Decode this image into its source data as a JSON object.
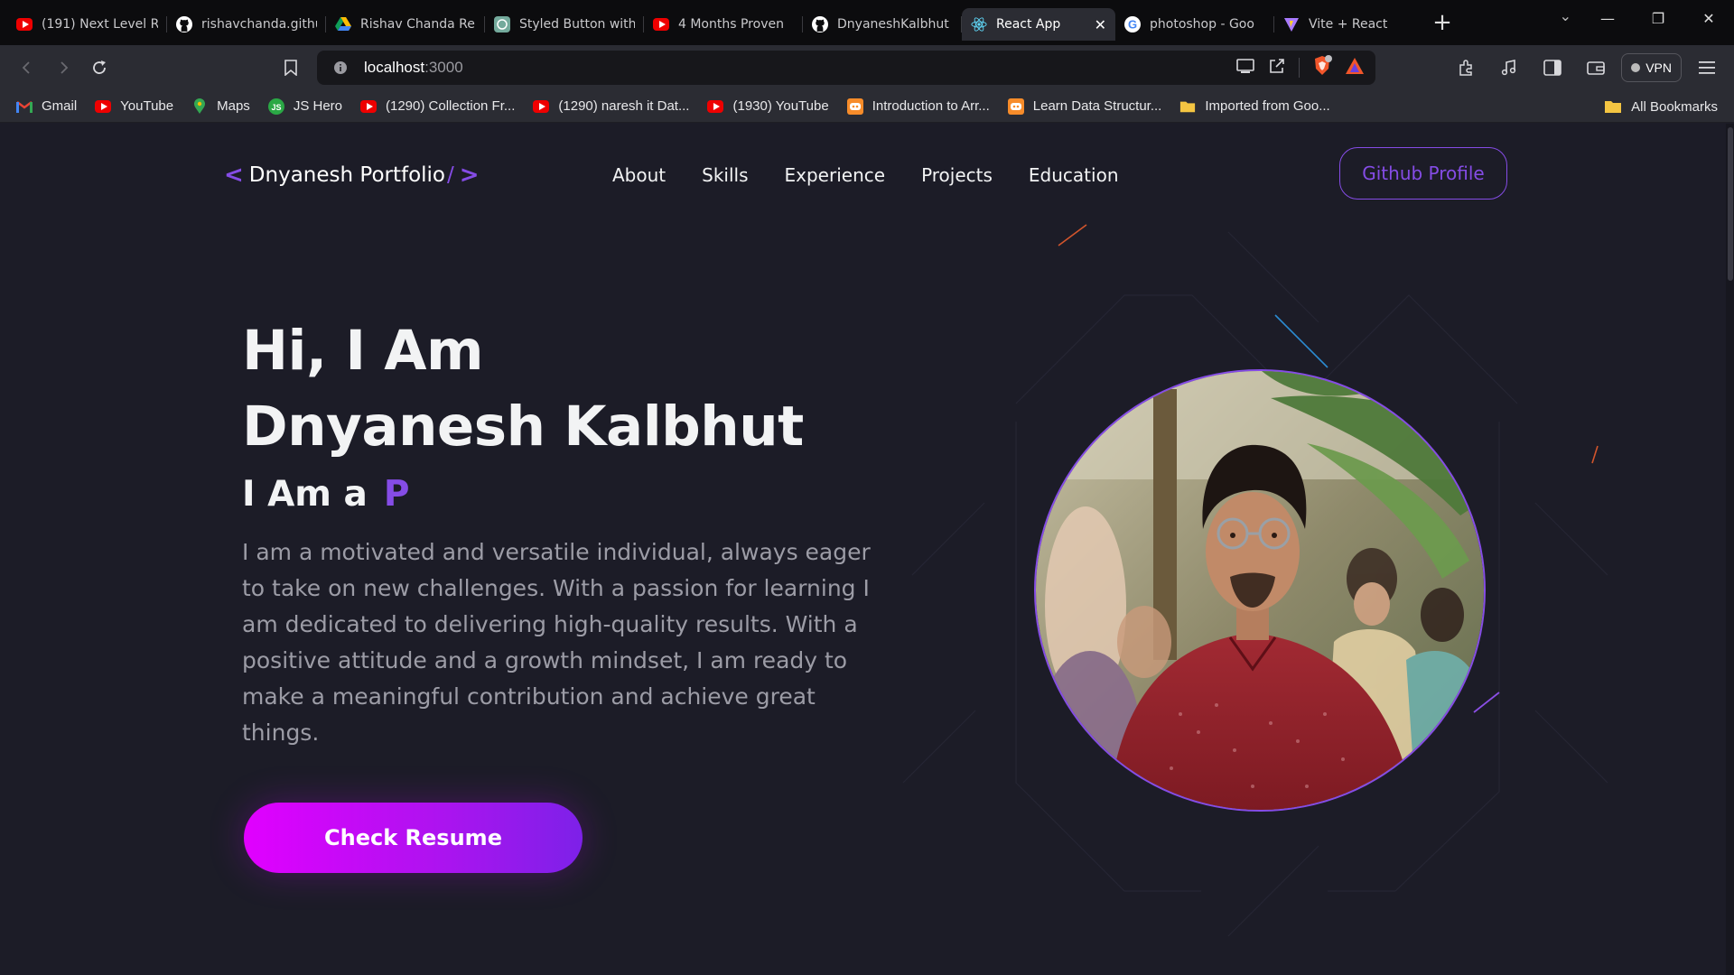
{
  "browser": {
    "tabs": [
      {
        "title": "(191) Next Level R",
        "icon": "youtube-icon"
      },
      {
        "title": "rishavchanda.githu",
        "icon": "github-icon"
      },
      {
        "title": "Rishav Chanda Re",
        "icon": "google-drive-icon"
      },
      {
        "title": "Styled Button with",
        "icon": "chatgpt-icon"
      },
      {
        "title": "4 Months Proven",
        "icon": "youtube-icon"
      },
      {
        "title": "DnyaneshKalbhut",
        "icon": "github-icon"
      },
      {
        "title": "React App",
        "icon": "react-icon",
        "active": true
      },
      {
        "title": "photoshop - Goo",
        "icon": "google-icon"
      },
      {
        "title": "Vite + React",
        "icon": "vite-icon"
      }
    ],
    "url": {
      "host": "localhost",
      "port": ":3000"
    },
    "vpn_label": "VPN",
    "bookmarks": [
      {
        "label": "Gmail",
        "icon": "gmail-icon"
      },
      {
        "label": "YouTube",
        "icon": "youtube-icon"
      },
      {
        "label": "Maps",
        "icon": "maps-icon"
      },
      {
        "label": "JS Hero",
        "icon": "jshero-icon"
      },
      {
        "label": "(1290) Collection Fr...",
        "icon": "youtube-icon"
      },
      {
        "label": "(1290) naresh it Dat...",
        "icon": "youtube-icon"
      },
      {
        "label": "(1930) YouTube",
        "icon": "youtube-icon"
      },
      {
        "label": "Introduction to Arr...",
        "icon": "codingninjas-icon"
      },
      {
        "label": "Learn Data Structur...",
        "icon": "codingninjas-icon"
      },
      {
        "label": "Imported from Goo...",
        "icon": "folder-icon"
      }
    ],
    "all_bookmarks": "All Bookmarks"
  },
  "nav": {
    "logo_text": "Dnyanesh Portfolio",
    "logo_open": "<",
    "logo_slash": "/",
    "logo_close": ">",
    "links": [
      "About",
      "Skills",
      "Experience",
      "Projects",
      "Education"
    ],
    "github_button": "Github Profile"
  },
  "hero": {
    "title_line1": "Hi, I Am",
    "title_line2": "Dnyanesh Kalbhut",
    "role_prefix": "I Am a",
    "role_typed": "P",
    "description": "I am a motivated and versatile individual, always eager to take on new challenges. With a passion for learning I am dedicated to delivering high-quality results. With a positive attitude and a growth mindset, I am ready to make a meaningful contribution and achieve great things.",
    "cta": "Check Resume"
  },
  "colors": {
    "accent": "#854ce6",
    "background": "#1c1c27",
    "cta_gradient_start": "#e100ff",
    "cta_gradient_end": "#7d21e8"
  }
}
